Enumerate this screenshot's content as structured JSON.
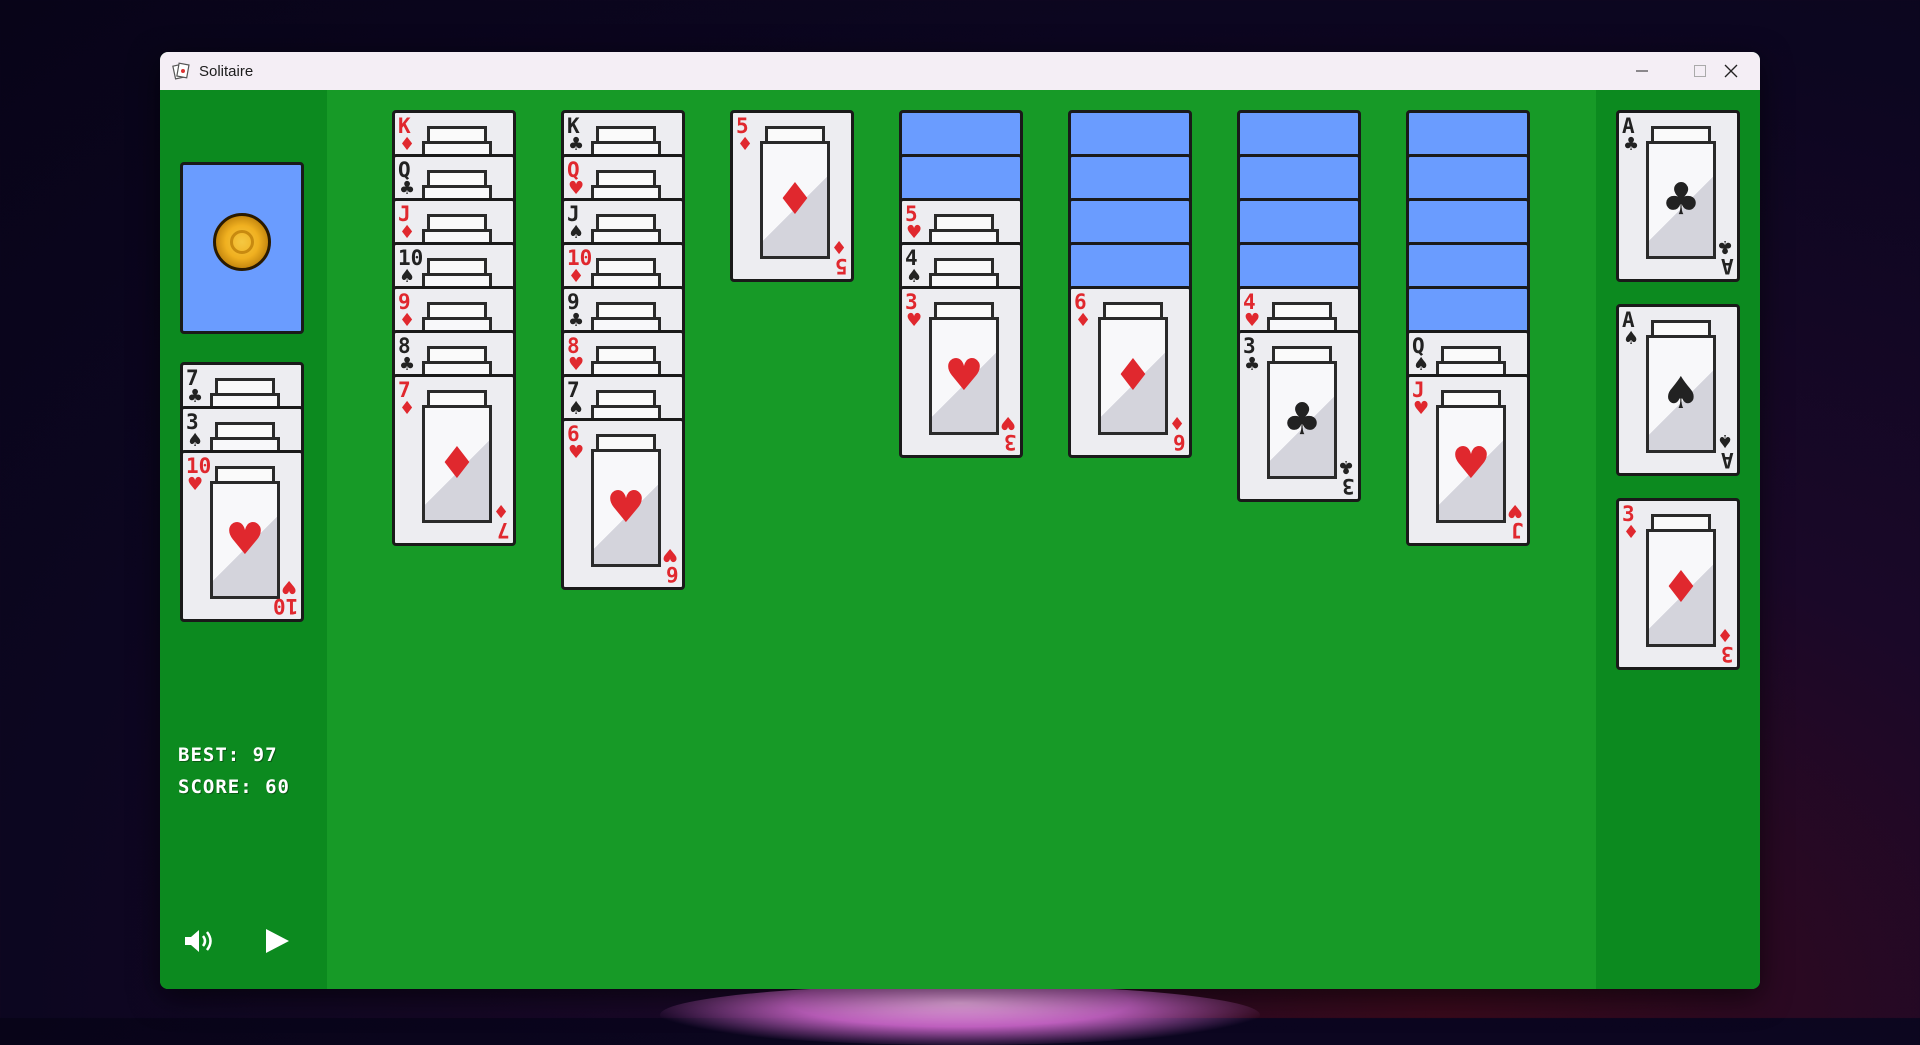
{
  "window": {
    "title": "Solitaire"
  },
  "stats": {
    "best": "BEST: 97",
    "score": "SCORE: 60"
  },
  "icons": {
    "sound": "sound-icon",
    "play": "play-icon",
    "minimize": "minimize-icon",
    "maximize": "maximize-icon",
    "close": "close-icon"
  },
  "colors": {
    "felt": "#179a27",
    "sidebar": "#0c8a1f",
    "card_back": "#6a9cff",
    "red_suit": "#e0282e",
    "black_suit": "#222222"
  },
  "waste": [
    {
      "rank": "7",
      "suit": "♣",
      "color": "black"
    },
    {
      "rank": "3",
      "suit": "♠",
      "color": "black"
    },
    {
      "rank": "10",
      "suit": "♥",
      "color": "red"
    }
  ],
  "tableau": [
    {
      "hidden": 0,
      "cards": [
        {
          "rank": "K",
          "suit": "♦",
          "color": "red"
        },
        {
          "rank": "Q",
          "suit": "♣",
          "color": "black"
        },
        {
          "rank": "J",
          "suit": "♦",
          "color": "red"
        },
        {
          "rank": "10",
          "suit": "♠",
          "color": "black"
        },
        {
          "rank": "9",
          "suit": "♦",
          "color": "red"
        },
        {
          "rank": "8",
          "suit": "♣",
          "color": "black"
        },
        {
          "rank": "7",
          "suit": "♦",
          "color": "red"
        }
      ]
    },
    {
      "hidden": 0,
      "cards": [
        {
          "rank": "K",
          "suit": "♣",
          "color": "black"
        },
        {
          "rank": "Q",
          "suit": "♥",
          "color": "red"
        },
        {
          "rank": "J",
          "suit": "♠",
          "color": "black"
        },
        {
          "rank": "10",
          "suit": "♦",
          "color": "red"
        },
        {
          "rank": "9",
          "suit": "♣",
          "color": "black"
        },
        {
          "rank": "8",
          "suit": "♥",
          "color": "red"
        },
        {
          "rank": "7",
          "suit": "♠",
          "color": "black"
        },
        {
          "rank": "6",
          "suit": "♥",
          "color": "red"
        }
      ]
    },
    {
      "hidden": 0,
      "cards": [
        {
          "rank": "5",
          "suit": "♦",
          "color": "red"
        }
      ]
    },
    {
      "hidden": 2,
      "cards": [
        {
          "rank": "5",
          "suit": "♥",
          "color": "red"
        },
        {
          "rank": "4",
          "suit": "♠",
          "color": "black"
        },
        {
          "rank": "3",
          "suit": "♥",
          "color": "red"
        }
      ]
    },
    {
      "hidden": 4,
      "cards": [
        {
          "rank": "6",
          "suit": "♦",
          "color": "red"
        }
      ]
    },
    {
      "hidden": 4,
      "cards": [
        {
          "rank": "4",
          "suit": "♥",
          "color": "red"
        },
        {
          "rank": "3",
          "suit": "♣",
          "color": "black"
        }
      ]
    },
    {
      "hidden": 5,
      "cards": [
        {
          "rank": "Q",
          "suit": "♠",
          "color": "black"
        },
        {
          "rank": "J",
          "suit": "♥",
          "color": "red"
        }
      ]
    }
  ],
  "foundations": [
    {
      "rank": "A",
      "suit": "♣",
      "color": "black"
    },
    {
      "rank": "A",
      "suit": "♠",
      "color": "black"
    },
    {
      "rank": "3",
      "suit": "♦",
      "color": "red"
    }
  ]
}
